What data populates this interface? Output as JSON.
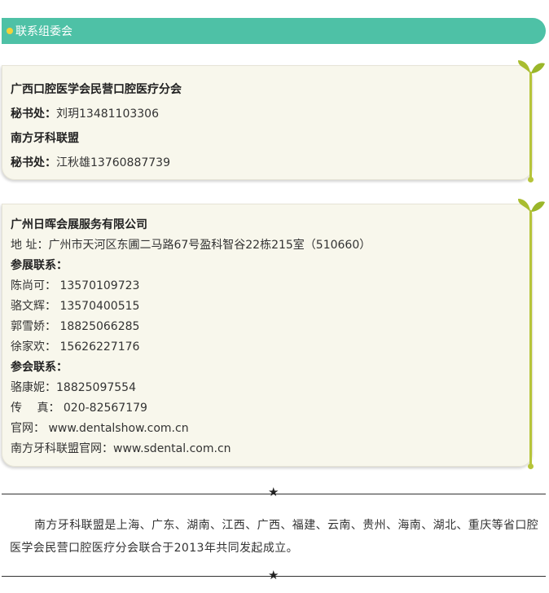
{
  "header": {
    "title": "联系组委会"
  },
  "card1": {
    "org1": "广西口腔医学会民营口腔医疗分会",
    "sec1_label": "秘书处：",
    "sec1_value": "刘玥13481103306",
    "org2": "南方牙科联盟",
    "sec2_label": "秘书处：",
    "sec2_value": "江秋雄13760887739"
  },
  "card2": {
    "company": "广州日晖会展服务有限公司",
    "address": "地 址：广州市天河区东圃二马路67号盈科智谷22栋215室（510660）",
    "exhibit_label": "参展联系：",
    "exhibit_contacts": [
      "陈尚可： 13570109723",
      "骆文辉： 13570400515",
      "郭雪娇： 18825066285",
      "徐家欢： 15626227176"
    ],
    "attend_label": "参会联系：",
    "attend_contact": "骆康妮：18825097554",
    "fax": "传　 真： 020-82567179",
    "website": "官网： www.dentalshow.com.cn",
    "alliance_website": "南方牙科联盟官网：www.sdental.com.cn"
  },
  "divider_star": "★",
  "paragraph": "南方牙科联盟是上海、广东、湖南、江西、广西、福建、云南、贵州、海南、湖北、重庆等省口腔医学会民营口腔医疗分会联合于2013年共同发起成立。",
  "colors": {
    "header": "#4ec1a6",
    "dot": "#f3d23a",
    "card": "#f8f7ec",
    "sprout": "#b6c43a"
  }
}
